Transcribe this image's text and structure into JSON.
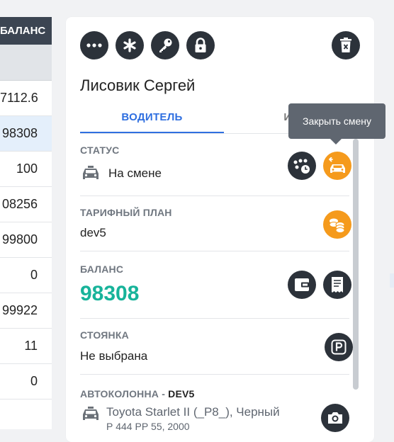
{
  "table": {
    "header": "БАЛАНС",
    "rows": [
      "7112.6",
      "98308",
      "100",
      "08256",
      "99800",
      "0",
      "99922",
      "11",
      "0"
    ]
  },
  "toolbar": {
    "more_icon": "more-dots-icon",
    "asterisk_icon": "asterisk-icon",
    "key_icon": "key-icon",
    "lock_icon": "lock-icon",
    "delete_icon": "trash-icon"
  },
  "driver": {
    "name": "Лисовик Сергей"
  },
  "tabs": [
    {
      "label": "ВОДИТЕЛЬ",
      "active": true
    },
    {
      "label": "ИСТ"
    }
  ],
  "tooltip": "Закрыть смену",
  "status": {
    "title": "СТАТУС",
    "value": "На смене"
  },
  "tariff": {
    "title": "ТАРИФНЫЙ ПЛАН",
    "value": "dev5"
  },
  "balance": {
    "title": "БАЛАНС",
    "value": "98308",
    "color": "#17b39a"
  },
  "parking": {
    "title": "СТОЯНКА",
    "value": "Не выбрана"
  },
  "fleet": {
    "title": "АВТОКОЛОННА",
    "sep": " - ",
    "code": "DEV5",
    "car": "Toyota Starlet II (_P8_), Черный",
    "plate": "Р 444 РР 55, 2000"
  },
  "colors": {
    "accent": "#2f6fe0",
    "orange": "#f59a1c",
    "dark": "#2c323a"
  }
}
